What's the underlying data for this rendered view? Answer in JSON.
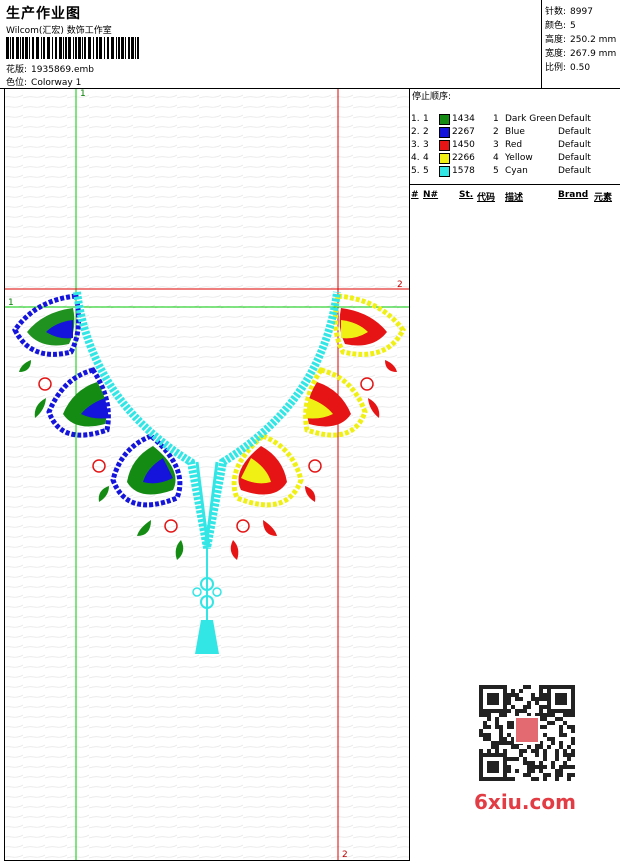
{
  "header": {
    "title": "生产作业图",
    "subtitle": "Wilcom(汇宏) 数饰工作室",
    "design_label": "花版:",
    "design_value": "1935869.emb",
    "colorway_label": "色位:",
    "colorway_value": "Colorway 1"
  },
  "stats": [
    {
      "label": "针数:",
      "value": "8997"
    },
    {
      "label": "颜色:",
      "value": "5"
    },
    {
      "label": "高度:",
      "value": "250.2 mm"
    },
    {
      "label": "宽度:",
      "value": "267.9 mm"
    },
    {
      "label": "比例:",
      "value": "0.50"
    }
  ],
  "colors": {
    "dark_green": "#148c14",
    "blue": "#1414dc",
    "red": "#e61414",
    "yellow": "#f0f014",
    "cyan": "#32e6e6",
    "guide_green": "#00c800",
    "guide_red": "#dc0000"
  },
  "stop_sequence": {
    "title": "停止顺序:",
    "headers": {
      "num": "#",
      "n": "N#",
      "st": "St.",
      "code": "代码",
      "desc": "描述",
      "brand": "Brand",
      "elem": "元素"
    },
    "rows": [
      {
        "num": "1.",
        "n": "1",
        "color": "#148c14",
        "st": "1434",
        "code": "1",
        "desc": "Dark Green",
        "brand": "Default"
      },
      {
        "num": "2.",
        "n": "2",
        "color": "#1414dc",
        "st": "2267",
        "code": "2",
        "desc": "Blue",
        "brand": "Default"
      },
      {
        "num": "3.",
        "n": "3",
        "color": "#e61414",
        "st": "1450",
        "code": "3",
        "desc": "Red",
        "brand": "Default"
      },
      {
        "num": "4.",
        "n": "4",
        "color": "#f0f014",
        "st": "2266",
        "code": "4",
        "desc": "Yellow",
        "brand": "Default"
      },
      {
        "num": "5.",
        "n": "5",
        "color": "#32e6e6",
        "st": "1578",
        "code": "5",
        "desc": "Cyan",
        "brand": "Default"
      }
    ]
  },
  "guides": {
    "v1": "1",
    "h1": "1",
    "h2": "2",
    "v2": "2"
  },
  "watermark": {
    "logo": "6xiu.com"
  }
}
